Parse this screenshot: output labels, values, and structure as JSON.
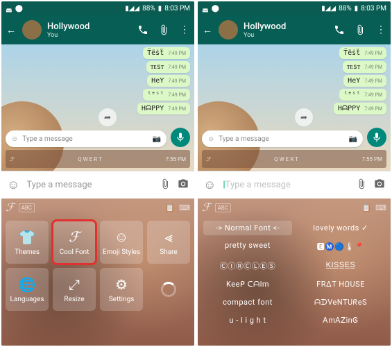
{
  "status": {
    "battery": "88%",
    "time": "8:03 PM"
  },
  "header": {
    "name": "Hollywood",
    "sub": "You"
  },
  "messages": [
    {
      "text": "T̈ëṡẗ",
      "time": "7:49 PM"
    },
    {
      "text": "ᴛᴇsᴛ",
      "time": "7:49 PM"
    },
    {
      "text": "HeY",
      "time": "7:49 PM"
    },
    {
      "text": "ᵗᵉˢᵗ",
      "time": "7:49 PM"
    },
    {
      "text": "HᗩPPY",
      "time": "7:49 PM"
    }
  ],
  "preview": {
    "placeholder": "Type a message",
    "kb_time": "7:55 PM"
  },
  "input": {
    "placeholder": "Type a message"
  },
  "kb": {
    "abc": "ABC"
  },
  "options": {
    "themes": "Themes",
    "coolfont": "Cool Font",
    "emojis": "Emoji Styles",
    "share": "Share",
    "languages": "Languages",
    "resize": "Resize",
    "settings": "Settings"
  },
  "fonts": {
    "c0": "-> Normal Font <-",
    "c1": "lovely words ✓",
    "c2": "pretty sweet",
    "c3": "🅴Ⓜ️🔵🌡📍",
    "c4": "ⒸⒾⓇⒸⓁⒺⓈ",
    "c5": "K̲I̲S̲S̲E̲S̲",
    "c6": "Keeᑭ ᑕᗩlm",
    "c7": "FRΔT HΩUSE",
    "c8": "compact font",
    "c9": "ᗩᗪVeNTUᖇeS",
    "c10": "u - l i g h t",
    "c11": "ᎪmᎪᏃᎥnᎶ"
  }
}
